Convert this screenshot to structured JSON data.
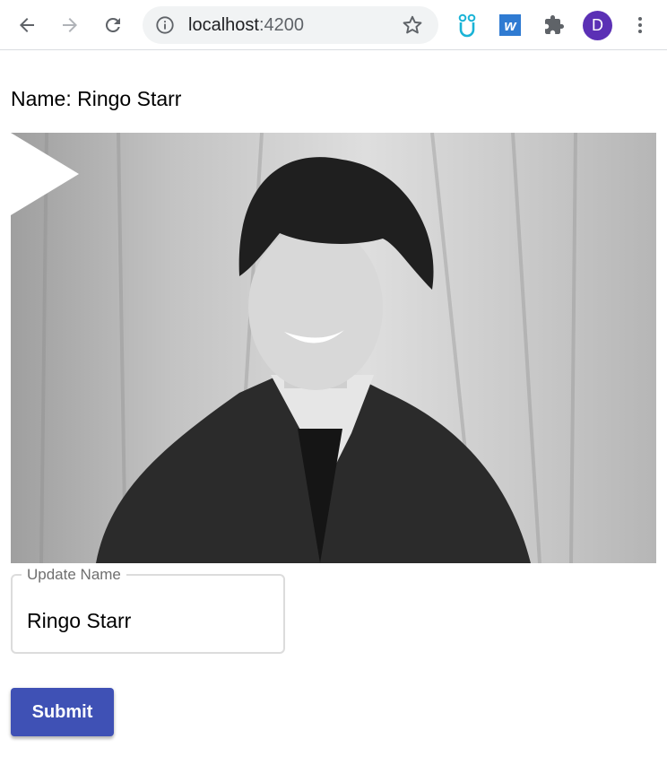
{
  "browser": {
    "url_host": "localhost",
    "url_port": ":4200",
    "profile_initial": "D",
    "extensions": [
      "owl-extension-icon",
      "w-extension-icon",
      "puzzle-piece-icon"
    ],
    "avatar_color": "#5b30b5"
  },
  "page": {
    "name_line": "Name: Ringo Starr",
    "field_label": "Update Name",
    "field_value": "Ringo Starr",
    "submit_label": "Submit",
    "accent_color": "#3f51b5"
  }
}
